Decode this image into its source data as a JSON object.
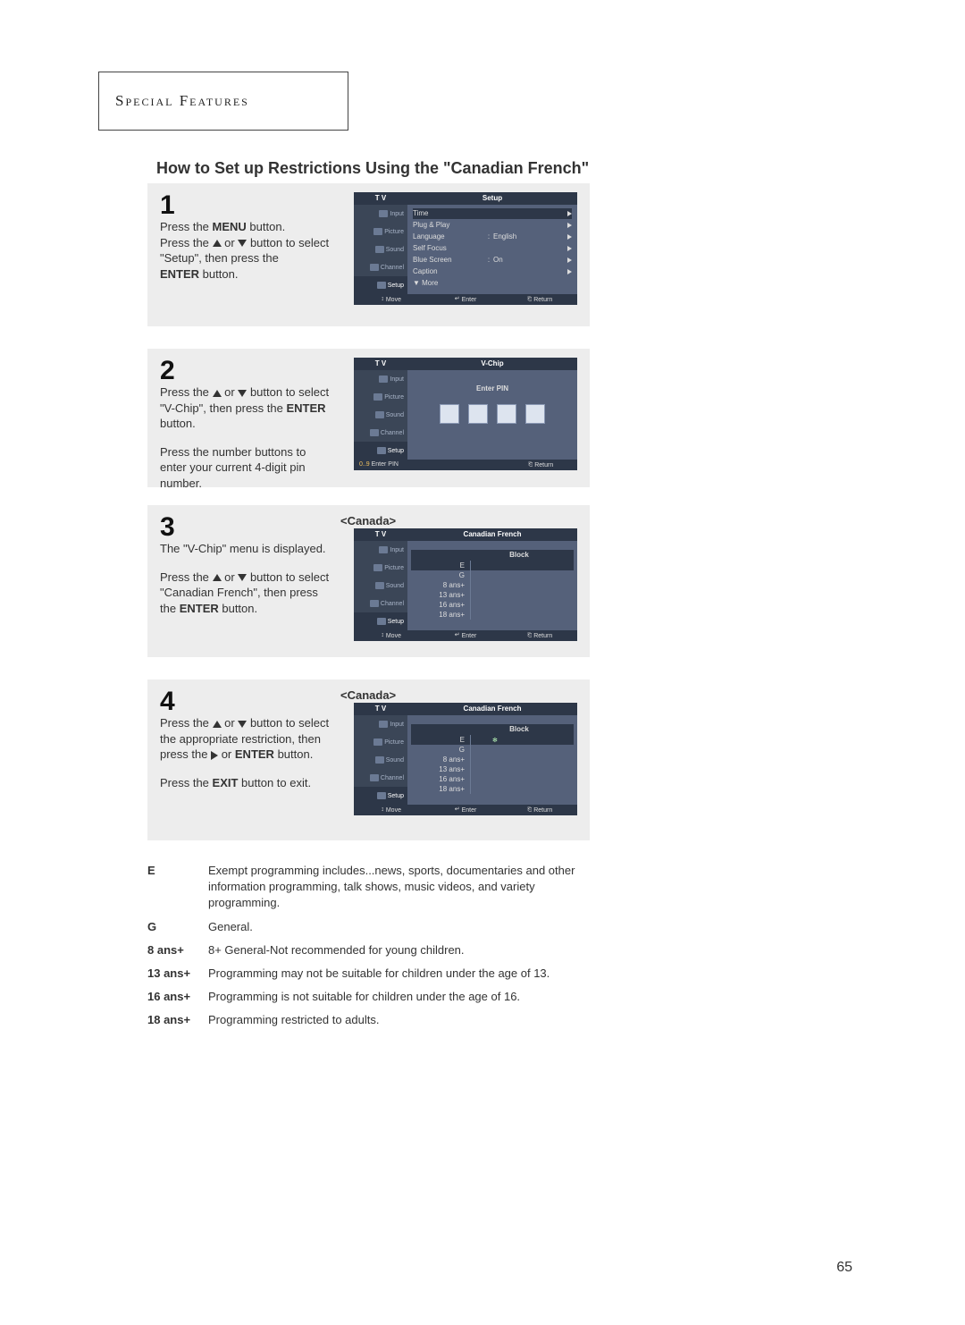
{
  "header": "Special Features",
  "page_title": "How to Set up Restrictions Using the \"Canadian French\"",
  "steps": {
    "s1": {
      "num": "1",
      "text_parts": {
        "a": "Press the ",
        "b": "MENU",
        "c": " button.",
        "d": "Press the ",
        "e": " or ",
        "f": " button to select \"Setup\", then press the ",
        "g": "ENTER",
        "h": " button."
      }
    },
    "s2": {
      "num": "2",
      "text_parts": {
        "a": "Press the ",
        "b": " or ",
        "c": " button to select \"V-Chip\", then press the ",
        "d": "ENTER",
        "e": " button.",
        "f": "Press the number buttons to enter your current 4-digit pin number."
      }
    },
    "s3": {
      "num": "3",
      "text_parts": {
        "a": "The \"V-Chip\" menu is displayed.",
        "b": "Press the ",
        "c": " or ",
        "d": " button to select \"Canadian French\", then press the ",
        "e": "ENTER",
        "f": " button."
      }
    },
    "s4": {
      "num": "4",
      "text_parts": {
        "a": "Press the ",
        "b": " or ",
        "c": " button to select the appropriate restriction, then press  the ",
        "d": " or ",
        "e": "ENTER",
        "f": " button.",
        "g": "Press the ",
        "h": "EXIT",
        "i": " button to exit."
      }
    }
  },
  "osd": {
    "tv_label": "T V",
    "side": [
      "Input",
      "Picture",
      "Sound",
      "Channel",
      "Setup"
    ],
    "setup": {
      "title": "Setup",
      "rows": [
        {
          "label": "Time",
          "val": ""
        },
        {
          "label": "Plug & Play",
          "val": ""
        },
        {
          "label": "Language",
          "val": "English"
        },
        {
          "label": "Self Focus",
          "val": ""
        },
        {
          "label": "Blue Screen",
          "val": "On"
        },
        {
          "label": "Caption",
          "val": ""
        },
        {
          "label": "▼ More",
          "val": "",
          "noarr": true
        }
      ],
      "footer": [
        "Move",
        "Enter",
        "Return"
      ]
    },
    "vchip": {
      "title": "V-Chip",
      "enter_pin": "Enter PIN",
      "footer": [
        "Enter PIN",
        "Return"
      ]
    },
    "cf": {
      "sublabel": "<Canada>",
      "title": "Canadian French",
      "block": "Block",
      "ratings": [
        "E",
        "G",
        "8 ans+",
        "13 ans+",
        "16 ans+",
        "18 ans+"
      ],
      "footer": [
        "Move",
        "Enter",
        "Return"
      ]
    }
  },
  "definitions": [
    {
      "label": "E",
      "desc": "Exempt programming includes...news, sports, documentaries and other information programming, talk shows, music videos, and  variety programming."
    },
    {
      "label": "G",
      "desc": "General."
    },
    {
      "label": "8  ans+",
      "desc": "8+ General-Not recommended for young children."
    },
    {
      "label": "13 ans+",
      "desc": "Programming may not be suitable for children under the age of 13."
    },
    {
      "label": "16 ans+",
      "desc": "Programming is not suitable for children under the age of 16."
    },
    {
      "label": "18 ans+",
      "desc": "Programming restricted to adults."
    }
  ],
  "page_number": "65"
}
